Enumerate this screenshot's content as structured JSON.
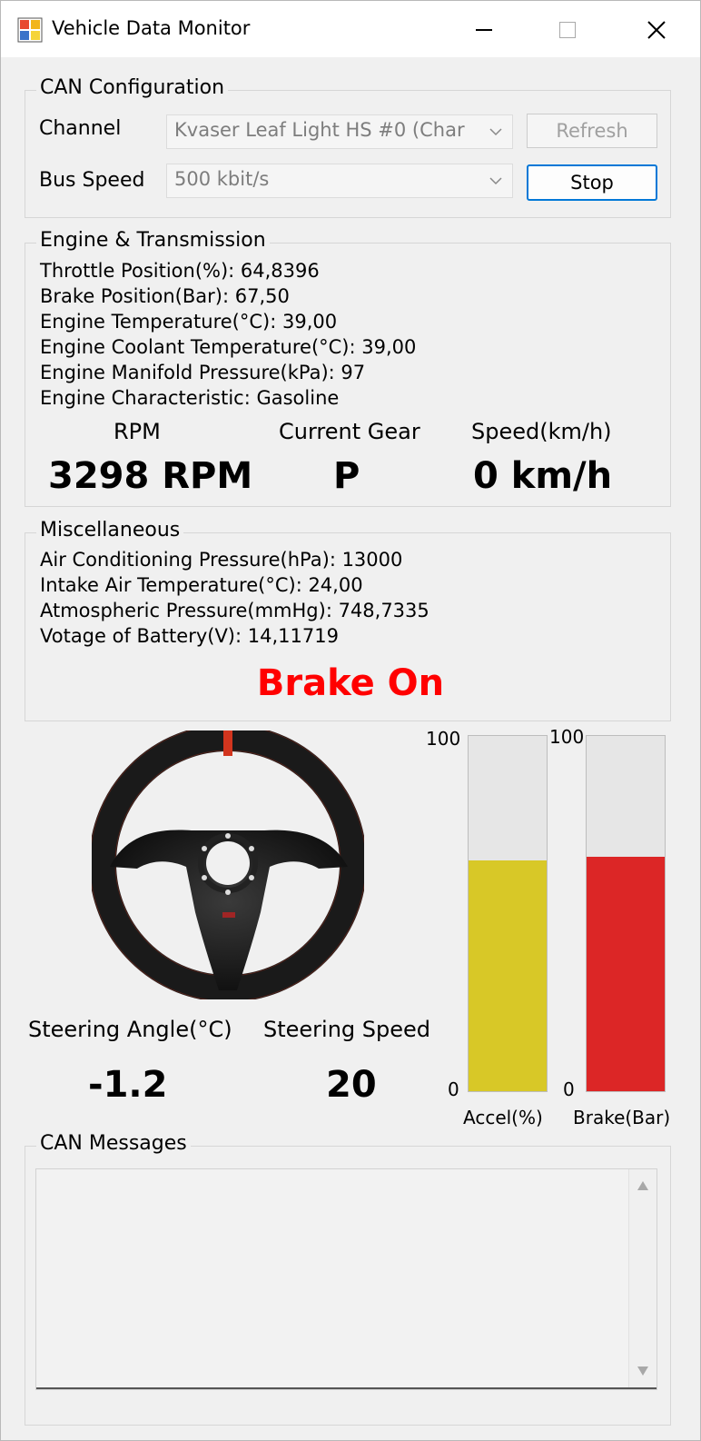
{
  "window": {
    "title": "Vehicle Data Monitor"
  },
  "can_config": {
    "legend": "CAN Configuration",
    "channel_label": "Channel",
    "channel_value": "Kvaser Leaf Light HS #0 (Char",
    "bus_speed_label": "Bus Speed",
    "bus_speed_value": "500 kbit/s",
    "refresh_label": "Refresh",
    "stop_label": "Stop"
  },
  "engine": {
    "legend": "Engine & Transmission",
    "lines": [
      "Throttle Position(%): 64,8396",
      "Brake Position(Bar): 67,50",
      "Engine Temperature(°C): 39,00",
      "Engine Coolant Temperature(°C): 39,00",
      "Engine Manifold Pressure(kPa): 97",
      "Engine Characteristic: Gasoline"
    ],
    "rpm_label": "RPM",
    "rpm_value": "3298 RPM",
    "gear_label": "Current Gear",
    "gear_value": "P",
    "speed_label": "Speed(km/h)",
    "speed_value": "0 km/h"
  },
  "misc": {
    "legend": "Miscellaneous",
    "lines": [
      "Air Conditioning Pressure(hPa): 13000",
      "Intake Air Temperature(°C): 24,00",
      "Atmospheric Pressure(mmHg): 748,7335",
      "Votage of Battery(V): 14,11719"
    ],
    "brake_status": "Brake On",
    "brake_status_color": "#ff0000"
  },
  "steering": {
    "angle_label": "Steering Angle(°C)",
    "angle_value": "-1.2",
    "speed_label": "Steering Speed",
    "speed_value": "20"
  },
  "gauges": {
    "accel": {
      "max_label": "100",
      "min_label": "0",
      "label": "Accel(%)",
      "level_percent": 65,
      "color": "#d8c827"
    },
    "brake": {
      "max_label": "100",
      "min_label": "0",
      "label": "Brake(Bar)",
      "level_percent": 66,
      "color": "#dc2626"
    }
  },
  "can_messages": {
    "legend": "CAN Messages"
  }
}
